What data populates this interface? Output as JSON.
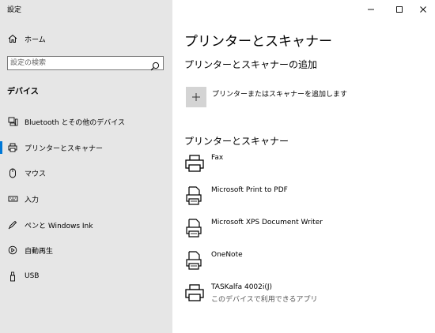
{
  "window": {
    "title": "設定"
  },
  "sidebar": {
    "home_label": "ホーム",
    "search_placeholder": "設定の検索",
    "section_title": "デバイス",
    "items": [
      {
        "label": "Bluetooth とその他のデバイス",
        "icon": "bluetooth-devices-icon"
      },
      {
        "label": "プリンターとスキャナー",
        "icon": "printer-icon",
        "selected": true
      },
      {
        "label": "マウス",
        "icon": "mouse-icon"
      },
      {
        "label": "入力",
        "icon": "keyboard-icon"
      },
      {
        "label": "ペンと Windows Ink",
        "icon": "pen-icon"
      },
      {
        "label": "自動再生",
        "icon": "autoplay-icon"
      },
      {
        "label": "USB",
        "icon": "usb-icon"
      }
    ]
  },
  "main": {
    "title": "プリンターとスキャナー",
    "add_section_title": "プリンターとスキャナーの追加",
    "add_button_label": "プリンターまたはスキャナーを追加します",
    "list_section_title": "プリンターとスキャナー",
    "printers": [
      {
        "name": "Fax",
        "icon": "fax-printer-icon"
      },
      {
        "name": "Microsoft Print to PDF",
        "icon": "document-printer-icon"
      },
      {
        "name": "Microsoft XPS Document Writer",
        "icon": "document-printer-icon"
      },
      {
        "name": "OneNote",
        "icon": "document-printer-icon"
      },
      {
        "name": "TASKalfa 4002i(J)",
        "status": "このデバイスで利用できるアプリ",
        "icon": "printer-icon"
      }
    ]
  },
  "colors": {
    "sidebar_bg": "#e6e6e6",
    "accent": "#0078d7",
    "add_tile": "#d4d4d4"
  }
}
